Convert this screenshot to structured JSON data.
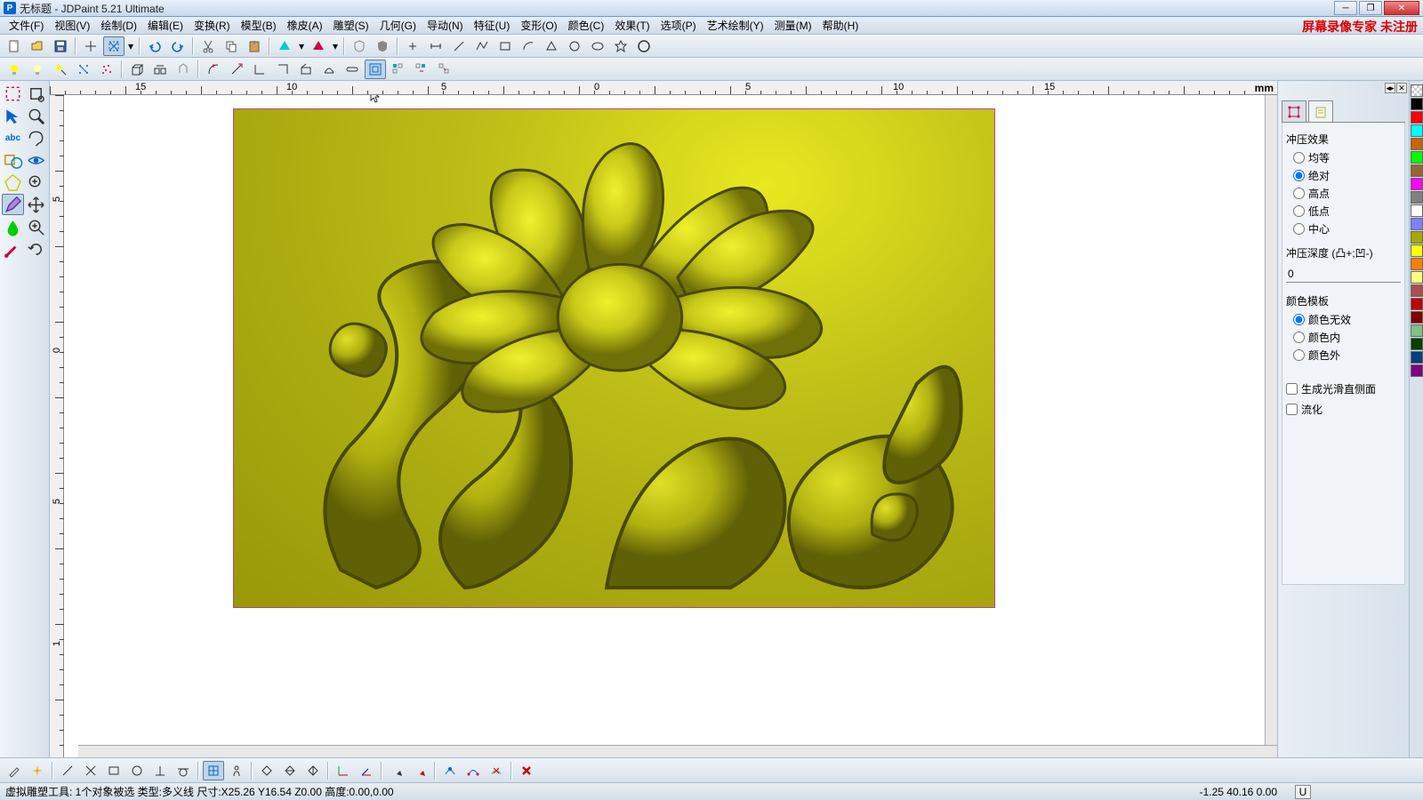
{
  "title": "无标题 - JDPaint 5.21 Ultimate",
  "watermark": "屏幕录像专家 未注册",
  "menu": [
    "文件(F)",
    "视图(V)",
    "绘制(D)",
    "编辑(E)",
    "变换(R)",
    "模型(B)",
    "橡皮(A)",
    "雕塑(S)",
    "几何(G)",
    "导动(N)",
    "特征(U)",
    "变形(O)",
    "颜色(C)",
    "效果(T)",
    "选项(P)",
    "艺术绘制(Y)",
    "测量(M)",
    "帮助(H)"
  ],
  "ruler": {
    "unit": "mm",
    "hTicks": [
      "15",
      "10",
      "5",
      "0",
      "5",
      "10",
      "15"
    ],
    "vTicks": [
      "5",
      "0",
      "5",
      "1"
    ]
  },
  "panel": {
    "group1": {
      "label": "冲压效果",
      "options": [
        "均等",
        "绝对",
        "高点",
        "低点",
        "中心"
      ],
      "selected": 1
    },
    "depth": {
      "label": "冲压深度 (凸+;凹-)",
      "value": "0"
    },
    "group2": {
      "label": "颜色模板",
      "options": [
        "颜色无效",
        "颜色内",
        "颜色外"
      ],
      "selected": 0
    },
    "checks": [
      "生成光滑直侧面",
      "流化"
    ]
  },
  "palette": [
    "#000000",
    "#ff0000",
    "#00ffff",
    "#c86400",
    "#00ff00",
    "#986432",
    "#ff00ff",
    "#808080",
    "#ffffff",
    "#8080ff",
    "#a8a800",
    "#ffff00",
    "#ff8000",
    "#ffff80",
    "#a85050",
    "#c00000",
    "#800000",
    "#80c080",
    "#004000",
    "#004080",
    "#800080"
  ],
  "status": {
    "left": "虚拟雕塑工具: 1个对象被选 类型:多义线 尺寸:X25.26 Y16.54 Z0.00 高度:0.00,0.00",
    "coords": "-1.25 40.16 0.00",
    "unit": "U"
  }
}
